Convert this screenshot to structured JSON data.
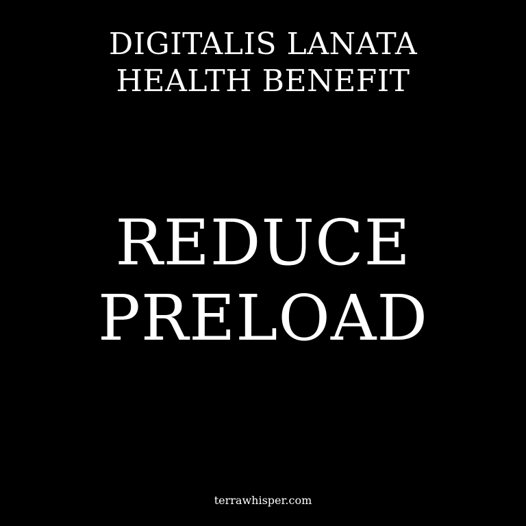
{
  "header": {
    "line1": "DIGITALIS LANATA",
    "line2": "HEALTH BENEFIT"
  },
  "headline": {
    "line1": "REDUCE",
    "line2": "PRELOAD"
  },
  "footer": {
    "site": "terrawhisper.com"
  },
  "colors": {
    "background": "#000000",
    "text": "#ffffff"
  }
}
